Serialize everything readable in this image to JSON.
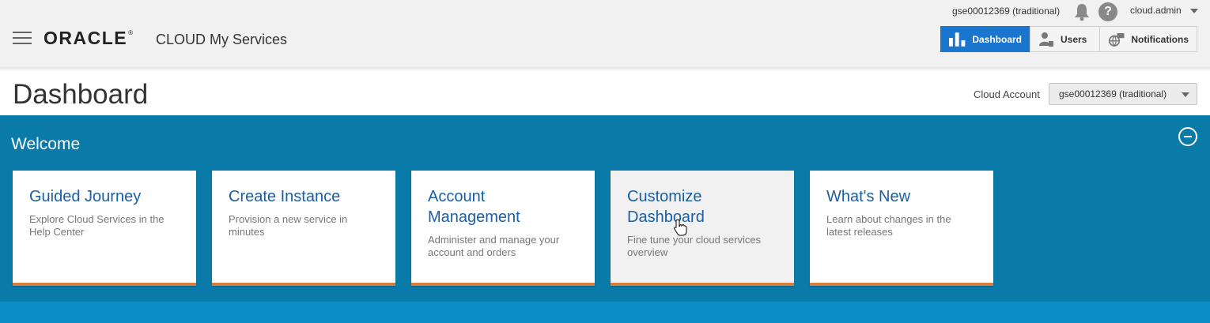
{
  "header": {
    "logo_text": "ORACLE",
    "logo_mark": "®",
    "service_name": "CLOUD My Services",
    "account_identity": "gse00012369 (traditional)",
    "user_name": "cloud.admin",
    "help_glyph": "?",
    "nav_tabs": [
      {
        "label": "Dashboard",
        "icon": "bar-chart-icon",
        "active": true
      },
      {
        "label": "Users",
        "icon": "user-icon",
        "active": false
      },
      {
        "label": "Notifications",
        "icon": "notifications-globe-icon",
        "active": false
      }
    ]
  },
  "page": {
    "title": "Dashboard",
    "cloud_account_label": "Cloud Account",
    "cloud_account_value": "gse00012369 (traditional)"
  },
  "welcome": {
    "title": "Welcome",
    "cards": [
      {
        "title": "Guided Journey",
        "description": "Explore Cloud Services in the Help Center"
      },
      {
        "title": "Create Instance",
        "description": "Provision a new service in minutes"
      },
      {
        "title": "Account Management",
        "description": "Administer and manage your account and orders"
      },
      {
        "title": "Customize Dashboard",
        "description": "Fine tune your cloud services overview"
      },
      {
        "title": "What's New",
        "description": "Learn about changes in the latest releases"
      }
    ]
  },
  "colors": {
    "active_tab": "#1a75cf",
    "welcome_bg": "#0a7ba9",
    "card_accent": "#d57e3e",
    "card_title": "#1a5ea3"
  }
}
